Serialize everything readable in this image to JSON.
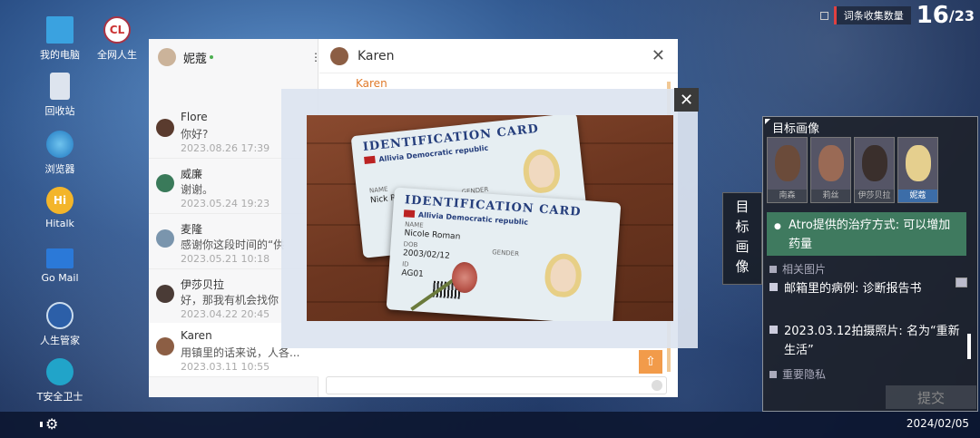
{
  "desktop": {
    "icons": [
      {
        "label": "我的电脑",
        "icon": "computer-icon"
      },
      {
        "label": "全网人生",
        "icon": "cl-app-icon",
        "glyph": "CL"
      },
      {
        "label": "回收站",
        "icon": "recycle-bin-icon"
      },
      {
        "label": "浏览器",
        "icon": "globe-icon"
      },
      {
        "label": "Hitalk",
        "icon": "hitalk-icon",
        "glyph": "Hi"
      },
      {
        "label": "Go Mail",
        "icon": "mail-icon"
      },
      {
        "label": "人生管家",
        "icon": "butler-icon"
      },
      {
        "label": "T安全卫士",
        "icon": "security-icon"
      }
    ]
  },
  "counter": {
    "label": "词条收集数量",
    "current": "16",
    "total": "/23"
  },
  "chat": {
    "self_name": "妮蔻",
    "menu_glyph": "⋮",
    "contacts": [
      {
        "name": "Flore",
        "message": "你好?",
        "date": "2023.08.26 17:39"
      },
      {
        "name": "威廉",
        "message": "谢谢。",
        "date": "2023.05.24 19:23"
      },
      {
        "name": "麦隆",
        "message": "感谢你这段时间的“供",
        "date": "2023.05.21 10:18"
      },
      {
        "name": "伊莎贝拉",
        "message": "好，那我有机会找你",
        "date": "2023.04.22 20:45"
      },
      {
        "name": "Karen",
        "message": "用镇里的话来说，人各...",
        "date": "2023.03.11 10:55"
      }
    ],
    "conversation_title": "Karen",
    "peek_sender": "Karen",
    "close_glyph": "✕"
  },
  "viewer": {
    "close_glyph": "✕",
    "cards": [
      {
        "title": "IDENTIFICATION CARD",
        "country": "Allivia Democratic republic",
        "name_label": "NAME",
        "name": "Nick Roman",
        "gender_label": "GENDER"
      },
      {
        "title": "IDENTIFICATION CARD",
        "country": "Allivia Democratic republic",
        "name_label": "NAME",
        "name": "Nicole Roman",
        "dob_label": "DOB",
        "dob": "2003/02/12",
        "id_label": "ID",
        "id": "AG01",
        "gender_label": "GENDER"
      }
    ]
  },
  "target_panel": {
    "title": "目标画像",
    "side_tab": [
      "目",
      "标",
      "画",
      "像"
    ],
    "portraits": [
      {
        "name": "南森",
        "selected": false
      },
      {
        "name": "莉丝",
        "selected": false
      },
      {
        "name": "伊莎贝拉",
        "selected": false
      },
      {
        "name": "妮蔻",
        "selected": true
      }
    ],
    "highlight": "Atro提供的治疗方式: 可以增加药量",
    "section_related": "相关图片",
    "items": [
      "邮箱里的病例: 诊断报告书",
      "2023.03.12拍摄照片: 名为“重新生活”"
    ],
    "section_privacy": "重要隐私",
    "submit_label": "提交"
  },
  "taskbar": {
    "date": "2024/02/05"
  }
}
